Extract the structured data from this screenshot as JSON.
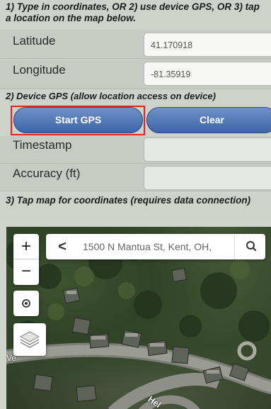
{
  "section1": {
    "heading": "1) Type in coordinates, OR 2) use device GPS, OR 3) tap a location on the map below.",
    "latitude_label": "Latitude",
    "latitude_value": "41.170918",
    "longitude_label": "Longitude",
    "longitude_value": "-81.35919"
  },
  "section2": {
    "heading": "2) Device GPS (allow location access on device)",
    "start_label": "Start GPS",
    "clear_label": "Clear",
    "timestamp_label": "Timestamp",
    "timestamp_value": "",
    "accuracy_label": "Accuracy (ft)",
    "accuracy_value": ""
  },
  "section3": {
    "heading": "3) Tap map for coordinates (requires data connection)"
  },
  "map": {
    "zoom_in": "+",
    "zoom_out": "−",
    "search_text": "1500 N Mantua St, Kent, OH,",
    "back_glyph": "<",
    "street_label_1": "Ve",
    "street_label_2": "Hel",
    "icons": [
      "chevron-left-icon",
      "search-icon",
      "locate-icon",
      "layers-icon"
    ]
  },
  "colors": {
    "button_blue": "#4a6fae",
    "highlight_red": "#e8202a"
  }
}
